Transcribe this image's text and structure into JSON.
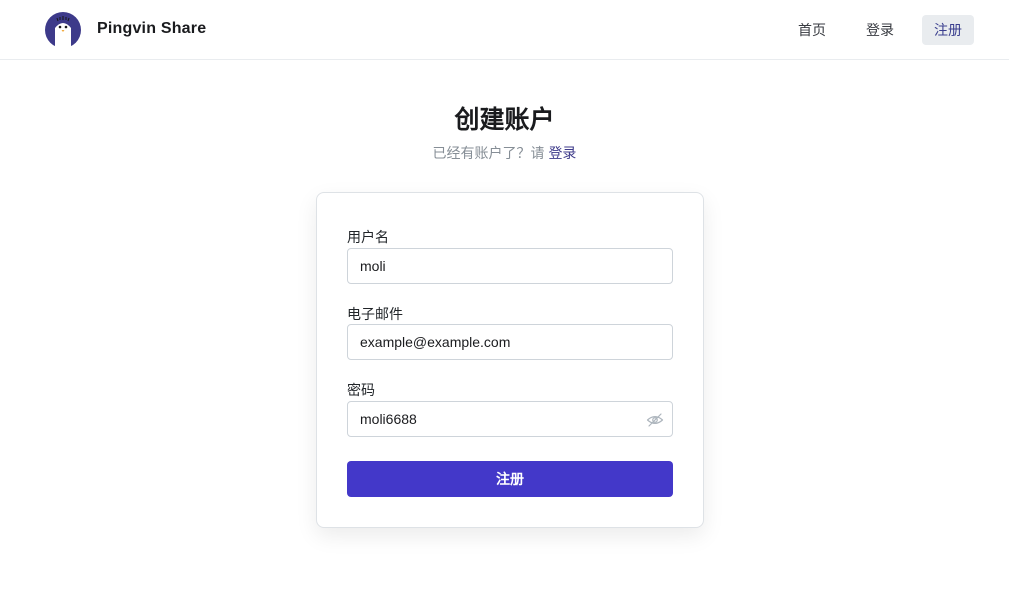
{
  "header": {
    "brand": "Pingvin Share",
    "logo_icon": "penguin-logo-icon",
    "nav": {
      "home": "首页",
      "login": "登录",
      "register": "注册"
    }
  },
  "main": {
    "title": "创建账户",
    "subtitle_prefix": "已经有账户了？请 ",
    "subtitle_link": "登录"
  },
  "form": {
    "username_label": "用户名",
    "username_value": "moli",
    "email_label": "电子邮件",
    "email_value": "example@example.com",
    "password_label": "密码",
    "password_value": "moli6688",
    "password_toggle_icon": "eye-off-icon",
    "submit_label": "注册"
  },
  "colors": {
    "primary": "#4338c9",
    "logo_bg": "#3d3a8a",
    "nav_active_bg": "#e9ecef"
  }
}
